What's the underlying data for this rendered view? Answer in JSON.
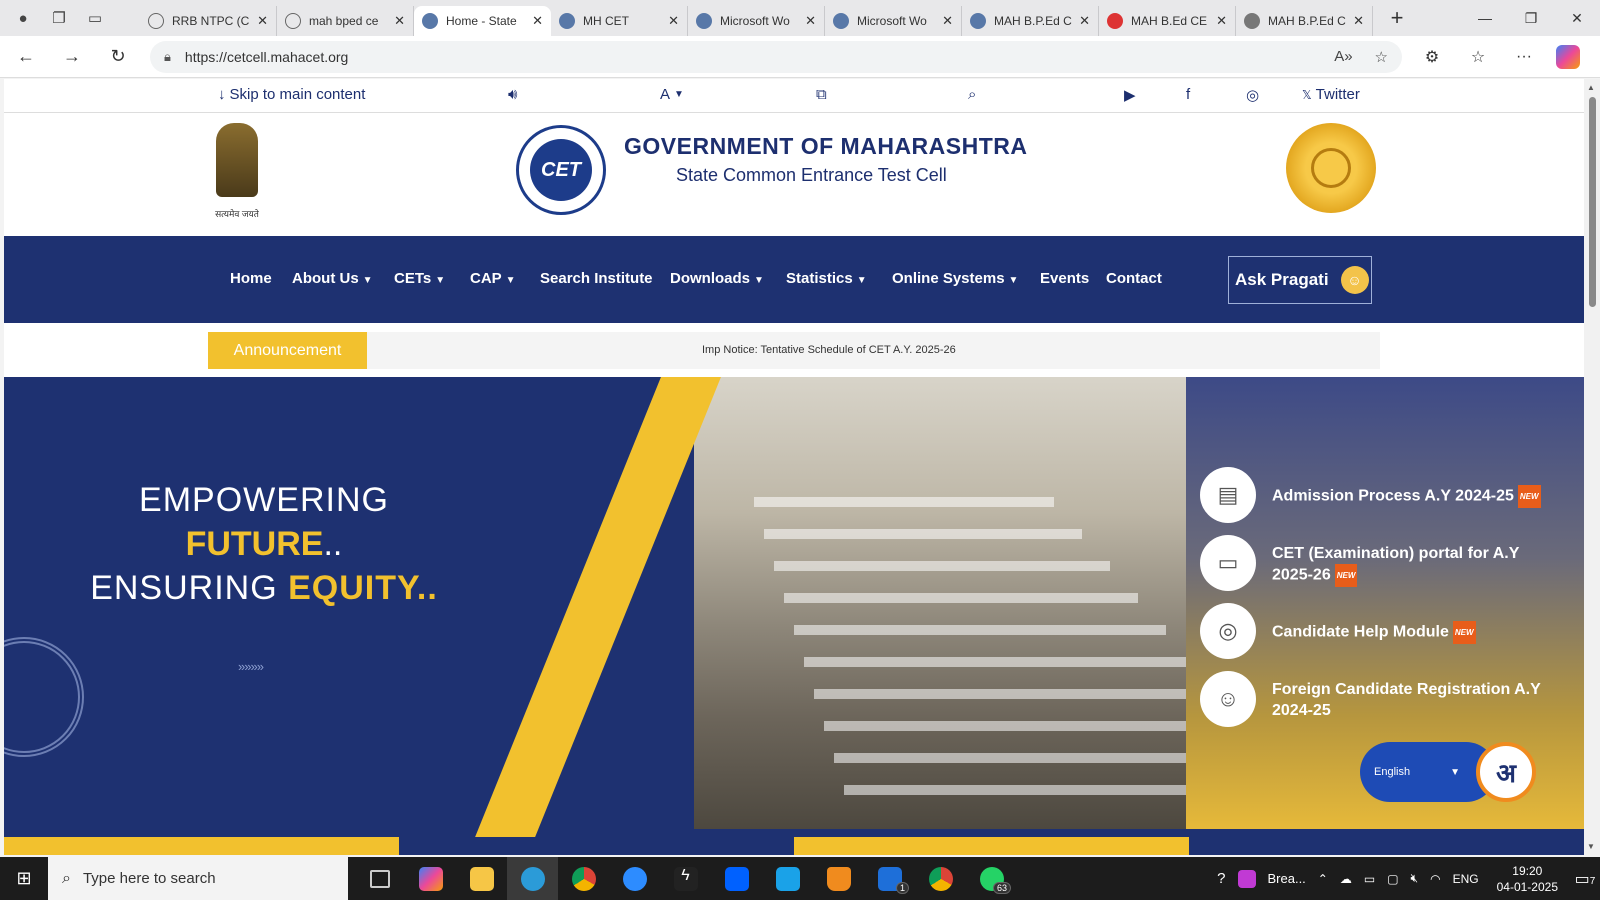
{
  "browser": {
    "tabs": [
      {
        "label": "RRB NTPC (C",
        "favicon": "globe-icon"
      },
      {
        "label": "mah bped ce",
        "favicon": "search-icon"
      },
      {
        "label": "Home - State",
        "favicon": "cet-icon",
        "active": true
      },
      {
        "label": "MH CET",
        "favicon": "cet-icon"
      },
      {
        "label": "Microsoft Wo",
        "favicon": "cet-icon"
      },
      {
        "label": "Microsoft Wo",
        "favicon": "cet-icon"
      },
      {
        "label": "MAH B.P.Ed C",
        "favicon": "doc-icon"
      },
      {
        "label": "MAH B.Ed CE",
        "favicon": "red-icon"
      },
      {
        "label": "MAH B.P.Ed C",
        "favicon": "gray-icon"
      }
    ],
    "url": "https://cetcell.mahacet.org"
  },
  "a11y": {
    "skip": "Skip to main content",
    "font": "A",
    "twitter": "Twitter"
  },
  "header": {
    "emblem_caption": "सत्यमेव जयते",
    "logo_text": "CET",
    "title": "GOVERNMENT OF MAHARASHTRA",
    "subtitle": "State Common Entrance Test Cell"
  },
  "nav": {
    "items": [
      "Home",
      "About Us",
      "CETs",
      "CAP",
      "Search Institute",
      "Downloads",
      "Statistics",
      "Online Systems",
      "Events",
      "Contact"
    ],
    "ask": "Ask Pragati"
  },
  "announcement": {
    "label": "Announcement",
    "text": "Imp Notice: Tentative Schedule of CET A.Y. 2025-26"
  },
  "hero": {
    "line1": "EMPOWERING",
    "line2": "FUTURE",
    "line2_dots": "..",
    "line3a": "ENSURING ",
    "line3b": "EQUITY..",
    "chevrons": "»»»»"
  },
  "quick_links": [
    {
      "text": "Admission Process A.Y 2024-25",
      "icon": "id-card-icon",
      "new": true
    },
    {
      "text": "CET (Examination) portal for A.Y 2025-26",
      "icon": "monitor-icon",
      "new": true
    },
    {
      "text": "Candidate Help Module",
      "icon": "headset-icon",
      "new": true
    },
    {
      "text": "Foreign Candidate Registration A.Y 2024-25",
      "icon": "user-icon",
      "new": false
    }
  ],
  "new_badge": "NEW",
  "language": {
    "selected": "English",
    "chatbot_letter": "अ"
  },
  "taskbar": {
    "search_placeholder": "Type here to search",
    "tray_app": "Brea...",
    "lang": "ENG",
    "time": "19:20",
    "date": "04-01-2025",
    "mail_badge": "1",
    "whatsapp_badge": "63",
    "notif_count": "7"
  },
  "colors": {
    "navy": "#1e3171",
    "yellow": "#f2c12e"
  }
}
